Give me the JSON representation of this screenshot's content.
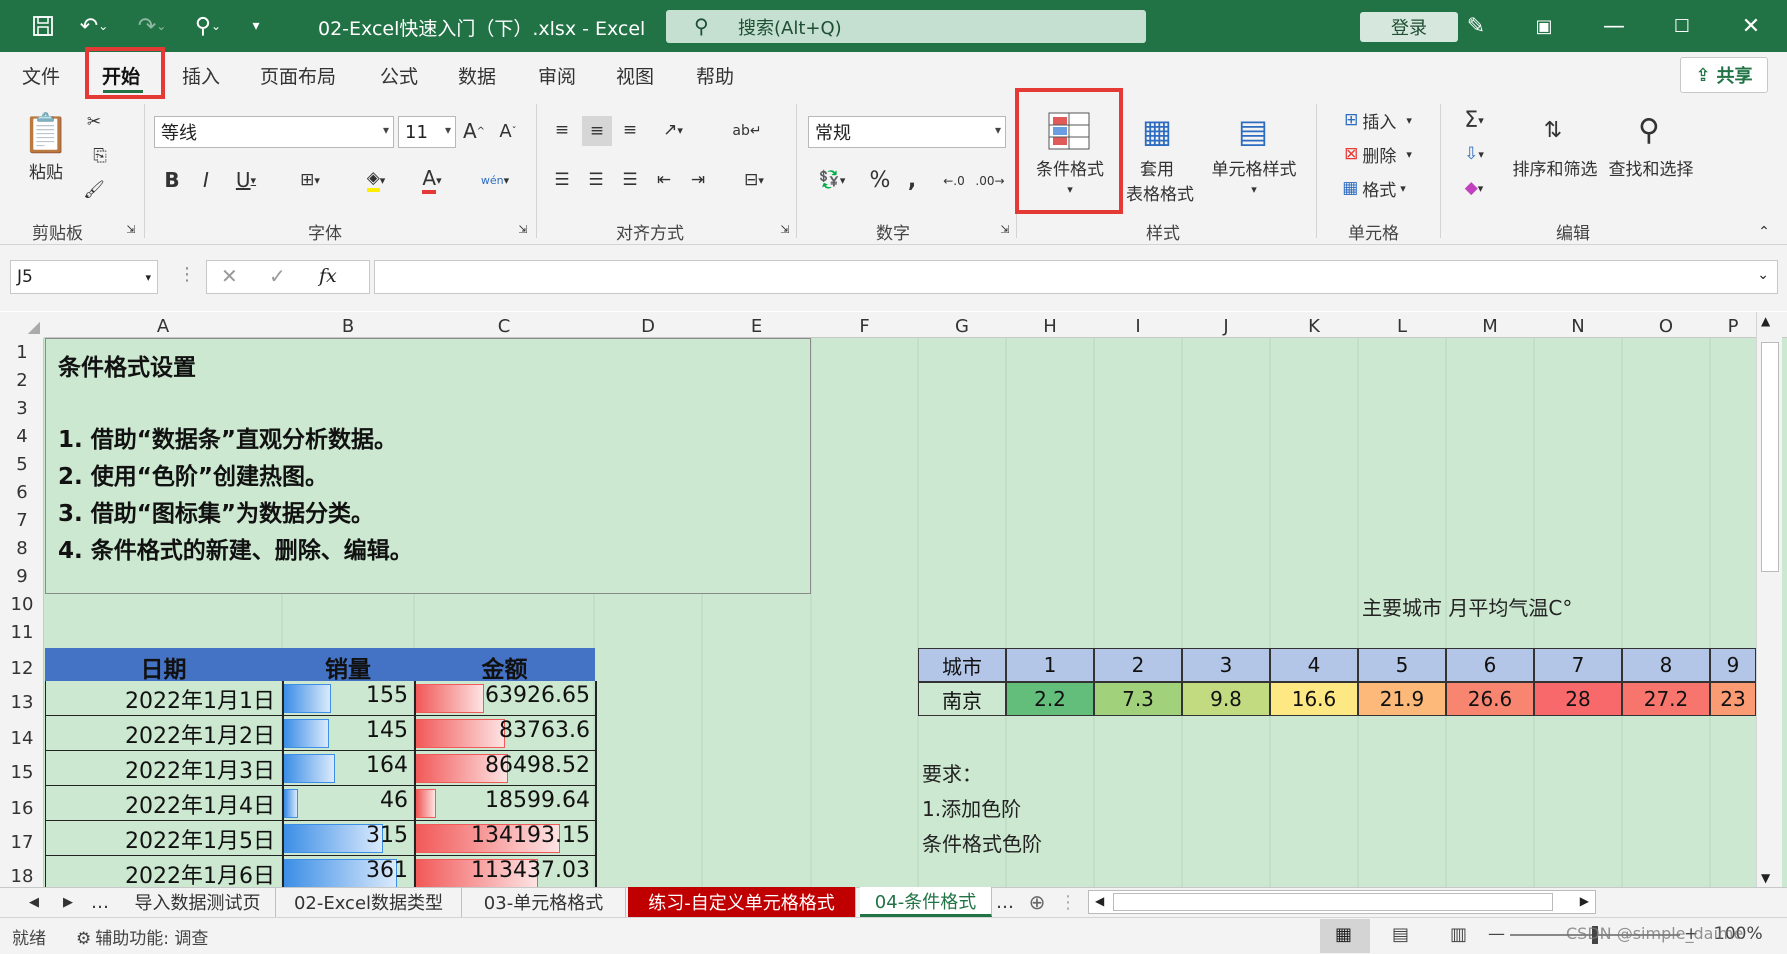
{
  "window": {
    "title": "02-Excel快速入门（下）.xlsx  -  Excel",
    "search_placeholder": "搜索(Alt+Q)",
    "login_label": "登录"
  },
  "menu": {
    "tabs": [
      "文件",
      "开始",
      "插入",
      "页面布局",
      "公式",
      "数据",
      "审阅",
      "视图",
      "帮助"
    ],
    "share_label": "共享"
  },
  "ribbon": {
    "clipboard": {
      "paste": "粘贴",
      "group": "剪贴板"
    },
    "font": {
      "name": "等线",
      "size": "11",
      "group": "字体",
      "wen": "wén"
    },
    "alignment": {
      "group": "对齐方式"
    },
    "number": {
      "format": "常规",
      "group": "数字"
    },
    "styles": {
      "conditional": "条件格式",
      "table_format_1": "套用",
      "table_format_2": "表格格式",
      "cell_styles": "单元格样式",
      "group": "样式"
    },
    "cells": {
      "insert": "插入",
      "delete": "删除",
      "format": "格式",
      "group": "单元格"
    },
    "editing": {
      "sort_filter": "排序和筛选",
      "find_select": "查找和选择",
      "group": "编辑"
    }
  },
  "formula_bar": {
    "name_box": "J5",
    "fx": "fx",
    "value": ""
  },
  "columns": [
    "A",
    "B",
    "C",
    "D",
    "E",
    "F",
    "G",
    "H",
    "I",
    "J",
    "K",
    "L",
    "M",
    "N",
    "O",
    "P"
  ],
  "rows": [
    "1",
    "2",
    "3",
    "4",
    "5",
    "6",
    "7",
    "8",
    "9",
    "10",
    "11",
    "12",
    "13",
    "14",
    "15",
    "16",
    "17",
    "18"
  ],
  "textbox": {
    "title": "条件格式设置",
    "lines": [
      "1. 借助“数据条”直观分析数据。",
      "2. 使用“色阶”创建热图。",
      "3. 借助“图标集”为数据分类。",
      "4. 条件格式的新建、删除、编辑。"
    ]
  },
  "sales_table": {
    "headers": [
      "日期",
      "销量",
      "金额"
    ],
    "rows": [
      {
        "date": "2022年1月1日",
        "qty": "155",
        "amount": "63926.65",
        "qty_frac": 0.37,
        "amt_frac": 0.47
      },
      {
        "date": "2022年1月2日",
        "qty": "145",
        "amount": "83763.6",
        "qty_frac": 0.35,
        "amt_frac": 0.62
      },
      {
        "date": "2022年1月3日",
        "qty": "164",
        "amount": "86498.52",
        "qty_frac": 0.4,
        "amt_frac": 0.64
      },
      {
        "date": "2022年1月4日",
        "qty": "46",
        "amount": "18599.64",
        "qty_frac": 0.11,
        "amt_frac": 0.14
      },
      {
        "date": "2022年1月5日",
        "qty": "315",
        "amount": "134193.15",
        "qty_frac": 0.77,
        "amt_frac": 1.0
      },
      {
        "date": "2022年1月6日",
        "qty": "361",
        "amount": "113437.03",
        "qty_frac": 0.88,
        "amt_frac": 0.85
      }
    ]
  },
  "temperature": {
    "title": "主要城市 月平均气温C°",
    "header_label": "城市",
    "months": [
      "1",
      "2",
      "3",
      "4",
      "5",
      "6",
      "7",
      "8",
      "9"
    ],
    "city": "南京",
    "values": [
      "2.2",
      "7.3",
      "9.8",
      "16.6",
      "21.9",
      "26.6",
      "28",
      "27.2",
      "23"
    ],
    "colors": [
      "#63be7b",
      "#a2d17c",
      "#c2da80",
      "#fde883",
      "#fcb97a",
      "#f8856f",
      "#f8696b",
      "#f8756d",
      "#fa9b73"
    ]
  },
  "requirements": [
    "要求：",
    "1.添加色阶",
    "条件格式色阶"
  ],
  "sheets": [
    "导入数据测试页",
    "02-Excel数据类型",
    "03-单元格格式",
    "练习-自定义单元格格式",
    "04-条件格式"
  ],
  "status": {
    "ready": "就绪",
    "accessibility": "辅助功能: 调查",
    "zoom": "100%",
    "watermark": "CSDN @simple_daime"
  }
}
